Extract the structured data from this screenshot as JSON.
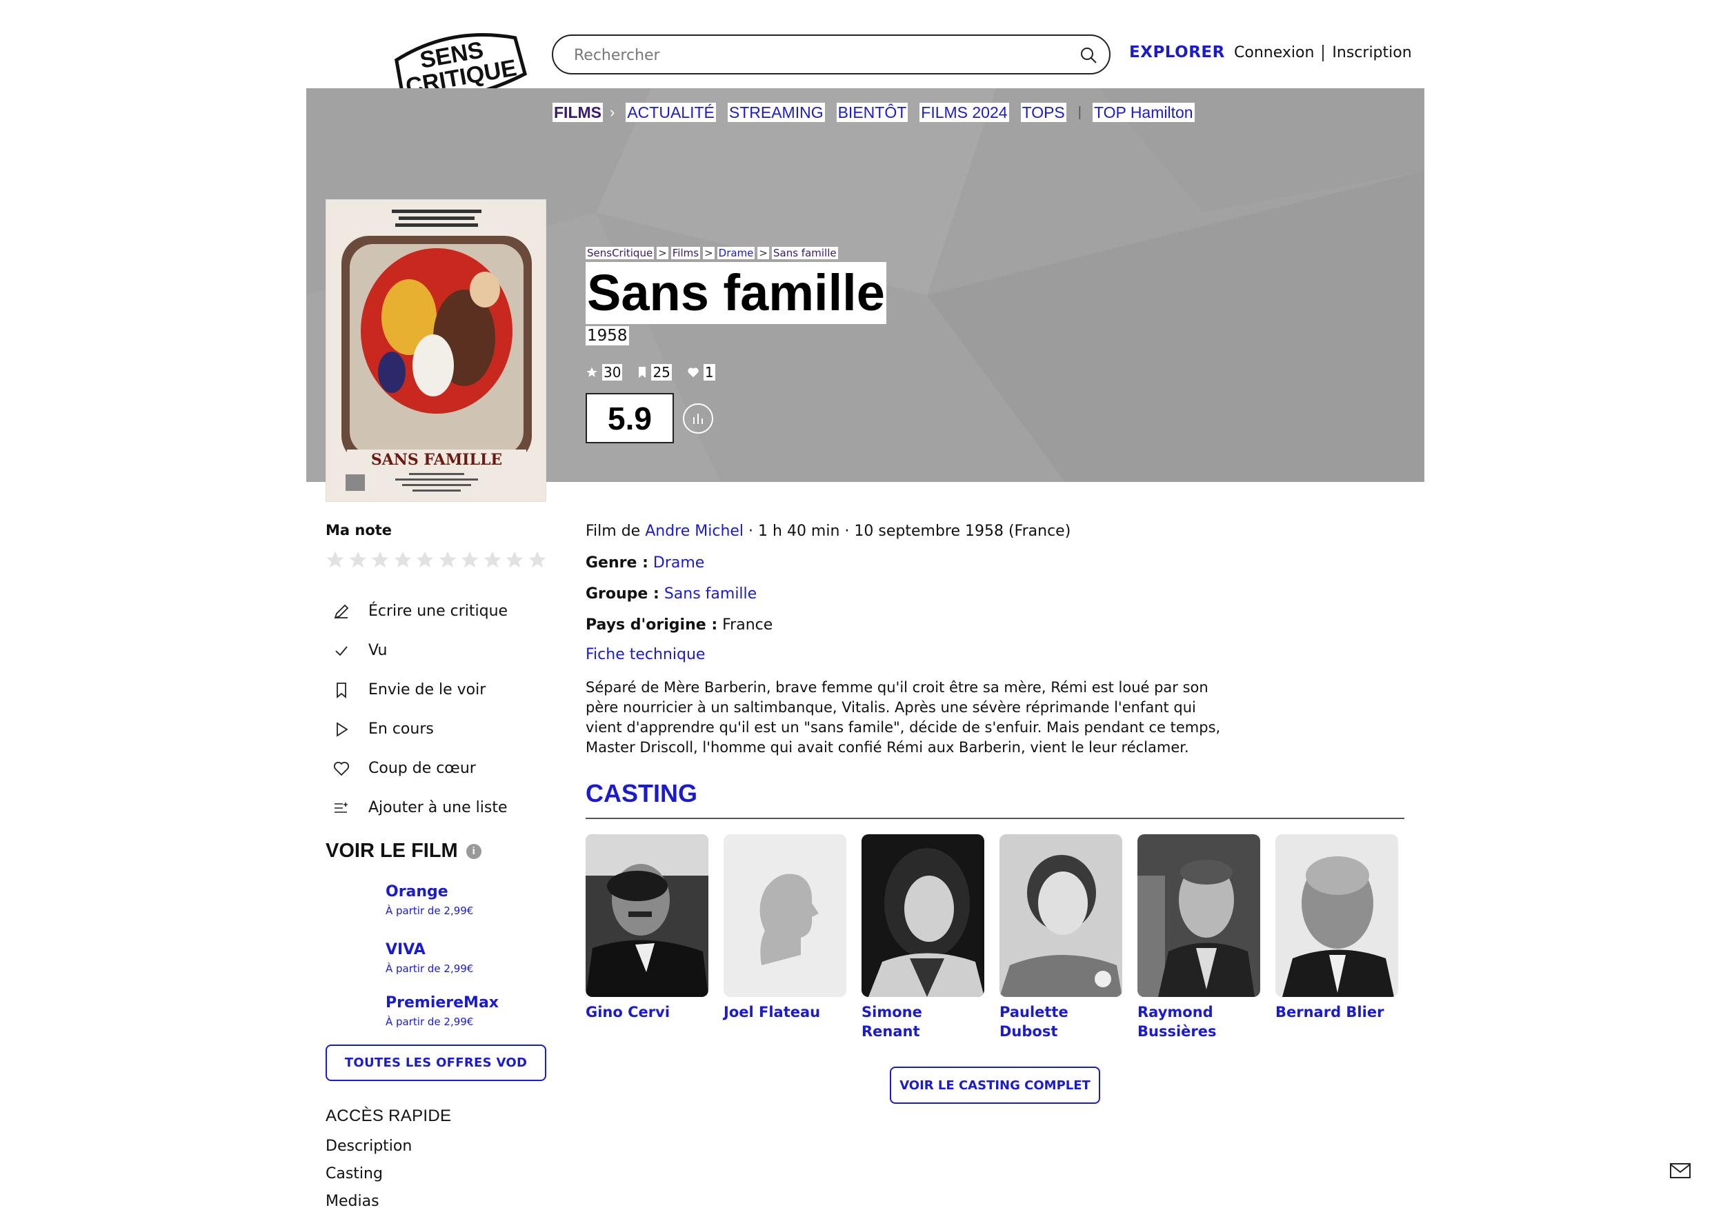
{
  "brand": {
    "logo_line1": "SENS",
    "logo_line2": "CRITIQUE"
  },
  "header": {
    "search_placeholder": "Rechercher",
    "explorer": "EXPLORER",
    "login": "Connexion",
    "signup": "Inscription"
  },
  "subnav": {
    "films": "FILMS",
    "items": [
      "ACTUALITÉ",
      "STREAMING",
      "BIENTÔT",
      "FILMS 2024",
      "TOPS"
    ],
    "extra": "TOP Hamilton"
  },
  "breadcrumb": [
    "SensCritique",
    "Films",
    "Drame",
    "Sans famille"
  ],
  "film": {
    "title": "Sans famille",
    "year": "1958",
    "ratings_count": "30",
    "wishlist_count": "25",
    "favorites_count": "1",
    "average": "5.9",
    "poster_title": "SANS FAMILLE"
  },
  "sidebar": {
    "ma_note": "Ma note",
    "actions": [
      {
        "label": "Écrire une critique",
        "icon": "pencil-icon"
      },
      {
        "label": "Vu",
        "icon": "check-icon"
      },
      {
        "label": "Envie de le voir",
        "icon": "bookmark-icon"
      },
      {
        "label": "En cours",
        "icon": "play-icon"
      },
      {
        "label": "Coup de cœur",
        "icon": "heart-icon"
      },
      {
        "label": "Ajouter à une liste",
        "icon": "add-list-icon"
      }
    ],
    "voir_title": "VOIR LE FILM",
    "offers": [
      {
        "name": "Orange",
        "price": "À partir de 2,99€"
      },
      {
        "name": "VIVA",
        "price": "À partir de 2,99€"
      },
      {
        "name": "PremiereMax",
        "price": "À partir de 2,99€"
      }
    ],
    "vod_button": "TOUTES LES OFFRES VOD",
    "acces_title": "ACCÈS RAPIDE",
    "acces_items": [
      "Description",
      "Casting",
      "Medias"
    ]
  },
  "details": {
    "film_de": "Film de",
    "director": "Andre Michel",
    "rest": "· 1 h 40 min · 10 septembre 1958 (France)",
    "genre_label": "Genre :",
    "genre": "Drame",
    "groupe_label": "Groupe :",
    "groupe": "Sans famille",
    "pays_label": "Pays d'origine :",
    "pays": "France",
    "fiche": "Fiche technique",
    "synopsis": "Séparé de Mère Barberin, brave femme qu'il croit être sa mère, Rémi est loué par son père nourricier à un saltimbanque, Vitalis. Après une sévère réprimande l'enfant qui vient d'apprendre qu'il est un \"sans famile\", décide de s'enfuir. Mais pendant ce temps, Master Driscoll, l'homme qui avait confié Rémi aux Barberin, vient le leur réclamer."
  },
  "casting": {
    "title": "CASTING",
    "actors": [
      {
        "name1": "Gino Cervi",
        "name2": ""
      },
      {
        "name1": "Joel Flateau",
        "name2": ""
      },
      {
        "name1": "Simone Renant",
        "name2": ""
      },
      {
        "name1": "Paulette",
        "name2": "Dubost"
      },
      {
        "name1": "Raymond",
        "name2": "Bussières"
      },
      {
        "name1": "Bernard Blier",
        "name2": ""
      }
    ],
    "button": "VOIR LE CASTING COMPLET"
  },
  "colors": {
    "accent": "#1a1ad0",
    "films_purple": "#3a1a6e",
    "hero_bg": "#a2a2a2"
  }
}
